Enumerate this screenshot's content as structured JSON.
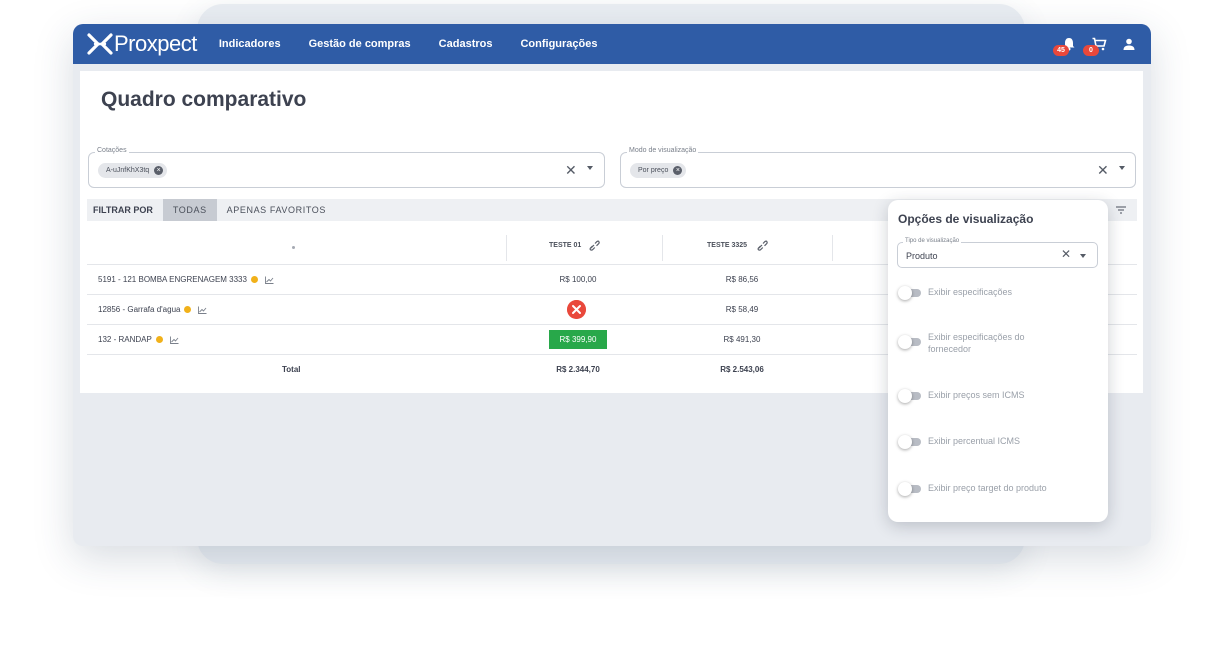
{
  "app": {
    "logo_text": "Proxpect",
    "nav": [
      "Indicadores",
      "Gestão de compras",
      "Cadastros",
      "Configurações"
    ],
    "notifications_badge": "45",
    "cart_badge": "0",
    "icons": [
      "bell-icon",
      "cart-icon",
      "user-icon"
    ]
  },
  "page": {
    "title": "Quadro comparativo"
  },
  "filters": {
    "cotacoes": {
      "label": "Cotações",
      "chip": "A-uJnfKhX3tq"
    },
    "modo": {
      "label": "Modo de visualização",
      "chip": "Por preço"
    }
  },
  "filterbar": {
    "label": "FILTRAR POR",
    "tabs": [
      "TODAS",
      "APENAS FAVORITOS"
    ],
    "active_tab": "TODAS"
  },
  "table": {
    "columns": [
      "TESTE 01",
      "TESTE 3325"
    ],
    "rows": [
      {
        "product": "5191 - 121 BOMBA ENGRENAGEM 3333",
        "teste01": "R$ 100,00",
        "teste3325": "R$ 86,56",
        "teste01_status": "normal"
      },
      {
        "product": "12856 - Garrafa d'agua",
        "teste01": "",
        "teste3325": "R$ 58,49",
        "teste01_status": "unavailable"
      },
      {
        "product": "132 - RANDAP",
        "teste01": "R$ 399,90",
        "teste3325": "R$ 491,30",
        "teste01_status": "highlight"
      }
    ],
    "total": {
      "label": "Total",
      "teste01": "R$ 2.344,70",
      "teste3325": "R$ 2.543,06"
    }
  },
  "panel": {
    "title": "Opções de visualização",
    "select_label": "Tipo de visualização",
    "select_value": "Produto",
    "options": [
      {
        "label": "Exibir especificações",
        "checked": false
      },
      {
        "label": "Exibir especificações do fornecedor",
        "checked": false
      },
      {
        "label": "Exibir preços sem ICMS",
        "checked": false
      },
      {
        "label": "Exibir percentual ICMS",
        "checked": false
      },
      {
        "label": "Exibir preço target do produto",
        "checked": false
      }
    ]
  },
  "colors": {
    "brand_blue": "#2f5ca6",
    "badge_red": "#e9483b",
    "success_green": "#28a84a",
    "favorite_yellow": "#f1b11a"
  }
}
